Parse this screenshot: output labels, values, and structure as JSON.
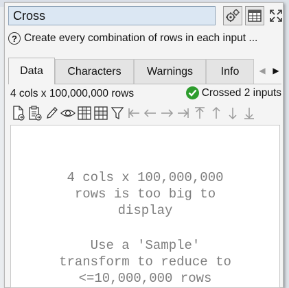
{
  "transform": {
    "name": "Cross",
    "description": "Create every combination of rows in each input ..."
  },
  "tabs": [
    {
      "label": "Data",
      "active": true
    },
    {
      "label": "Characters",
      "active": false
    },
    {
      "label": "Warnings",
      "active": false
    },
    {
      "label": "Info",
      "active": false
    }
  ],
  "status": {
    "dimensions": "4 cols x 100,000,000 rows",
    "message": "Crossed 2 inputs",
    "color": "#2e9d2e"
  },
  "toolbar_icons": [
    "export-file-icon",
    "copy-clipboard-icon",
    "edit-pencil-icon",
    "view-eye-icon",
    "columns-icon",
    "rows-icon",
    "filter-icon",
    "first-column-icon",
    "previous-column-icon",
    "next-column-icon",
    "last-column-icon",
    "first-row-icon",
    "previous-row-icon",
    "next-row-icon",
    "last-row-icon"
  ],
  "data_message": {
    "line1": "4 cols x 100,000,000",
    "line2": "rows is too big to",
    "line3": "display",
    "line4": "Use a 'Sample'",
    "line5": "transform to reduce to",
    "line6": "<=10,000,000 rows"
  },
  "colors": {
    "input_bg": "#dbe7f3",
    "panel_bg": "#f4f4f4",
    "message_text": "#7e7e7e"
  }
}
